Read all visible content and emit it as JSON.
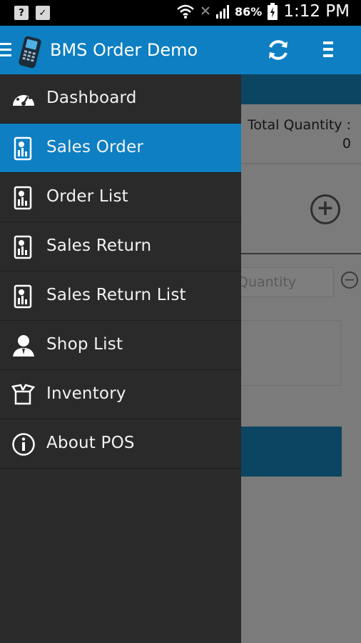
{
  "status_bar": {
    "battery": "86%",
    "time": "1:12 PM",
    "left_icons": [
      "help-icon",
      "briefcase-icon"
    ]
  },
  "app_bar": {
    "title": "BMS Order Demo"
  },
  "background": {
    "total_quantity_label": "Total Quantity :",
    "total_quantity_value": "0",
    "quantity_placeholder": "Quantity"
  },
  "drawer": {
    "items": [
      {
        "label": "Dashboard",
        "icon": "dashboard-icon",
        "active": false
      },
      {
        "label": "Sales Order",
        "icon": "report-icon",
        "active": true
      },
      {
        "label": "Order List",
        "icon": "report-icon",
        "active": false
      },
      {
        "label": "Sales Return",
        "icon": "report-icon",
        "active": false
      },
      {
        "label": "Sales Return List",
        "icon": "report-icon",
        "active": false
      },
      {
        "label": "Shop List",
        "icon": "user-icon",
        "active": false
      },
      {
        "label": "Inventory",
        "icon": "box-icon",
        "active": false
      },
      {
        "label": "About POS",
        "icon": "info-icon",
        "active": false
      }
    ]
  },
  "colors": {
    "primary": "#0d7fc2",
    "drawer_bg": "#2a2a2a",
    "dark_accent": "#0b4561"
  }
}
